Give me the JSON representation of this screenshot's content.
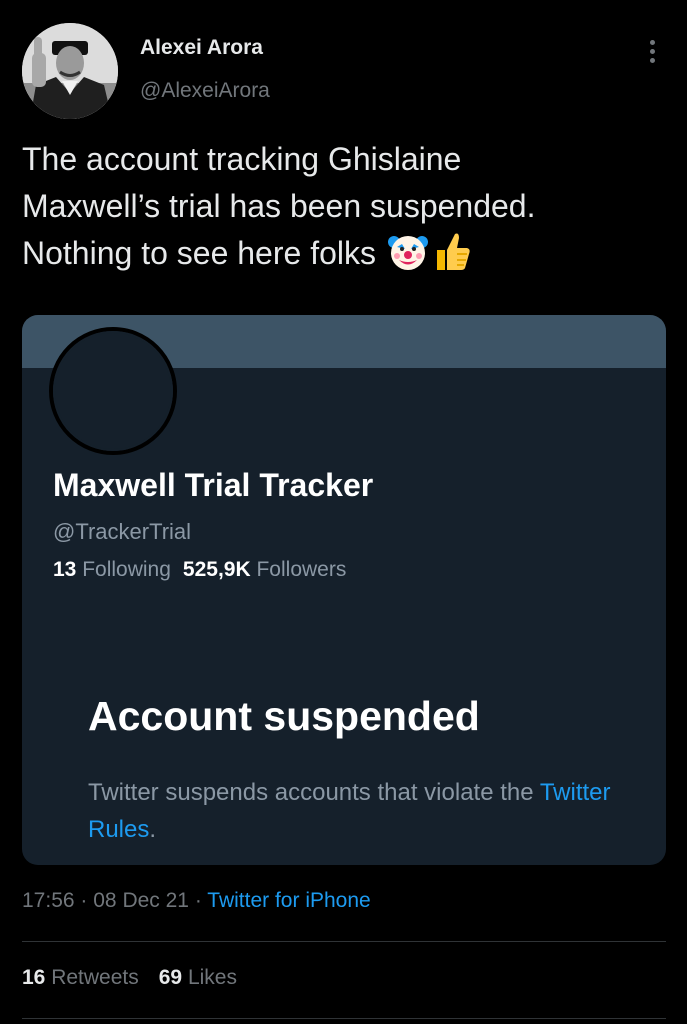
{
  "author": {
    "name": "Alexei Arora",
    "handle": "@AlexeiArora"
  },
  "tweet": {
    "lines": [
      "The account tracking Ghislaine",
      "Maxwell’s trial has been suspended.",
      "Nothing to see here folks"
    ],
    "emojis": [
      "clown-face-emoji",
      "thumbs-up-emoji"
    ]
  },
  "embedded_card": {
    "name": "Maxwell Trial Tracker",
    "handle": "@TrackerTrial",
    "following_count": "13",
    "following_label": "Following",
    "followers_count": "525,9K",
    "followers_label": "Followers",
    "suspended_title": "Account suspended",
    "suspended_text": "Twitter suspends accounts that violate the",
    "rules_link": "Twitter Rules",
    "rules_suffix": ".",
    "banner_color": "#3d5466",
    "card_color": "#15202b"
  },
  "meta": {
    "time": "17:56",
    "separator": "·",
    "date": "08 Dec 21",
    "source": "Twitter for iPhone"
  },
  "engagement": {
    "retweets_count": "16",
    "retweets_label": "Retweets",
    "likes_count": "69",
    "likes_label": "Likes"
  },
  "colors": {
    "background": "#000000",
    "text": "#e7e9ea",
    "secondary": "#71767b",
    "link": "#1d9bf0"
  }
}
